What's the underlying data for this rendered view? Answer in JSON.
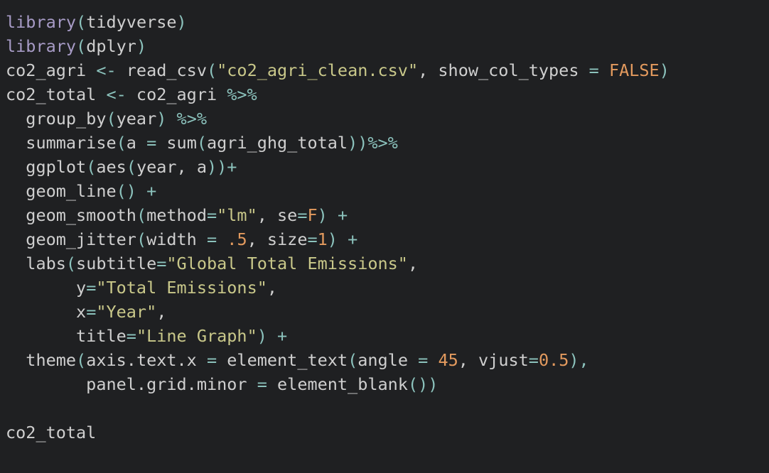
{
  "editor": {
    "background": "#1f2022",
    "colors": {
      "function": "#a79bc6",
      "plain": "#cfcfcf",
      "operator": "#8cc3bd",
      "string": "#c9c88a",
      "number": "#e39a5e"
    },
    "lines": [
      [
        {
          "t": "library",
          "c": "fn"
        },
        {
          "t": "(",
          "c": "op"
        },
        {
          "t": "tidyverse",
          "c": "pl"
        },
        {
          "t": ")",
          "c": "op"
        }
      ],
      [
        {
          "t": "library",
          "c": "fn"
        },
        {
          "t": "(",
          "c": "op"
        },
        {
          "t": "dplyr",
          "c": "pl"
        },
        {
          "t": ")",
          "c": "op"
        }
      ],
      [
        {
          "t": "co2_agri ",
          "c": "pl"
        },
        {
          "t": "<-",
          "c": "op"
        },
        {
          "t": " read_csv",
          "c": "pl"
        },
        {
          "t": "(",
          "c": "op"
        },
        {
          "t": "\"co2_agri_clean.csv\"",
          "c": "str"
        },
        {
          "t": ", show_col_types ",
          "c": "pl"
        },
        {
          "t": "=",
          "c": "op"
        },
        {
          "t": " ",
          "c": "pl"
        },
        {
          "t": "FALSE",
          "c": "num"
        },
        {
          "t": ")",
          "c": "op"
        }
      ],
      [
        {
          "t": "co2_total ",
          "c": "pl"
        },
        {
          "t": "<-",
          "c": "op"
        },
        {
          "t": " co2_agri ",
          "c": "pl"
        },
        {
          "t": "%>%",
          "c": "op"
        }
      ],
      [
        {
          "t": "  group_by",
          "c": "pl"
        },
        {
          "t": "(",
          "c": "op"
        },
        {
          "t": "year",
          "c": "pl"
        },
        {
          "t": ")",
          "c": "op"
        },
        {
          "t": " ",
          "c": "pl"
        },
        {
          "t": "%>%",
          "c": "op"
        }
      ],
      [
        {
          "t": "  summarise",
          "c": "pl"
        },
        {
          "t": "(",
          "c": "op"
        },
        {
          "t": "a ",
          "c": "pl"
        },
        {
          "t": "=",
          "c": "op"
        },
        {
          "t": " sum",
          "c": "pl"
        },
        {
          "t": "(",
          "c": "op"
        },
        {
          "t": "agri_ghg_total",
          "c": "pl"
        },
        {
          "t": "))%>%",
          "c": "op"
        }
      ],
      [
        {
          "t": "  ggplot",
          "c": "pl"
        },
        {
          "t": "(",
          "c": "op"
        },
        {
          "t": "aes",
          "c": "pl"
        },
        {
          "t": "(",
          "c": "op"
        },
        {
          "t": "year, a",
          "c": "pl"
        },
        {
          "t": "))+",
          "c": "op"
        }
      ],
      [
        {
          "t": "  geom_line",
          "c": "pl"
        },
        {
          "t": "()",
          "c": "op"
        },
        {
          "t": " ",
          "c": "pl"
        },
        {
          "t": "+",
          "c": "op"
        }
      ],
      [
        {
          "t": "  geom_smooth",
          "c": "pl"
        },
        {
          "t": "(",
          "c": "op"
        },
        {
          "t": "method",
          "c": "pl"
        },
        {
          "t": "=",
          "c": "op"
        },
        {
          "t": "\"lm\"",
          "c": "str"
        },
        {
          "t": ", se",
          "c": "pl"
        },
        {
          "t": "=",
          "c": "op"
        },
        {
          "t": "F",
          "c": "num"
        },
        {
          "t": ")",
          "c": "op"
        },
        {
          "t": " ",
          "c": "pl"
        },
        {
          "t": "+",
          "c": "op"
        }
      ],
      [
        {
          "t": "  geom_jitter",
          "c": "pl"
        },
        {
          "t": "(",
          "c": "op"
        },
        {
          "t": "width ",
          "c": "pl"
        },
        {
          "t": "=",
          "c": "op"
        },
        {
          "t": " ",
          "c": "pl"
        },
        {
          "t": ".5",
          "c": "num"
        },
        {
          "t": ", size",
          "c": "pl"
        },
        {
          "t": "=",
          "c": "op"
        },
        {
          "t": "1",
          "c": "num"
        },
        {
          "t": ")",
          "c": "op"
        },
        {
          "t": " ",
          "c": "pl"
        },
        {
          "t": "+",
          "c": "op"
        }
      ],
      [
        {
          "t": "  labs",
          "c": "pl"
        },
        {
          "t": "(",
          "c": "op"
        },
        {
          "t": "subtitle",
          "c": "pl"
        },
        {
          "t": "=",
          "c": "op"
        },
        {
          "t": "\"Global Total Emissions\"",
          "c": "str"
        },
        {
          "t": ",",
          "c": "pl"
        }
      ],
      [
        {
          "t": "       y",
          "c": "pl"
        },
        {
          "t": "=",
          "c": "op"
        },
        {
          "t": "\"Total Emissions\"",
          "c": "str"
        },
        {
          "t": ",",
          "c": "pl"
        }
      ],
      [
        {
          "t": "       x",
          "c": "pl"
        },
        {
          "t": "=",
          "c": "op"
        },
        {
          "t": "\"Year\"",
          "c": "str"
        },
        {
          "t": ",",
          "c": "pl"
        }
      ],
      [
        {
          "t": "       title",
          "c": "pl"
        },
        {
          "t": "=",
          "c": "op"
        },
        {
          "t": "\"Line Graph\"",
          "c": "str"
        },
        {
          "t": ")",
          "c": "op"
        },
        {
          "t": " ",
          "c": "pl"
        },
        {
          "t": "+",
          "c": "op"
        }
      ],
      [
        {
          "t": "  theme",
          "c": "pl"
        },
        {
          "t": "(",
          "c": "op"
        },
        {
          "t": "axis.text.x ",
          "c": "pl"
        },
        {
          "t": "=",
          "c": "op"
        },
        {
          "t": " element_text",
          "c": "pl"
        },
        {
          "t": "(",
          "c": "op"
        },
        {
          "t": "angle ",
          "c": "pl"
        },
        {
          "t": "=",
          "c": "op"
        },
        {
          "t": " ",
          "c": "pl"
        },
        {
          "t": "45",
          "c": "num"
        },
        {
          "t": ", vjust",
          "c": "pl"
        },
        {
          "t": "=",
          "c": "op"
        },
        {
          "t": "0.5",
          "c": "num"
        },
        {
          "t": "),",
          "c": "op"
        }
      ],
      [
        {
          "t": "        panel.grid.minor ",
          "c": "pl"
        },
        {
          "t": "=",
          "c": "op"
        },
        {
          "t": " element_blank",
          "c": "pl"
        },
        {
          "t": "())",
          "c": "op"
        }
      ],
      [],
      [
        {
          "t": "co2_total",
          "c": "pl"
        }
      ]
    ]
  }
}
